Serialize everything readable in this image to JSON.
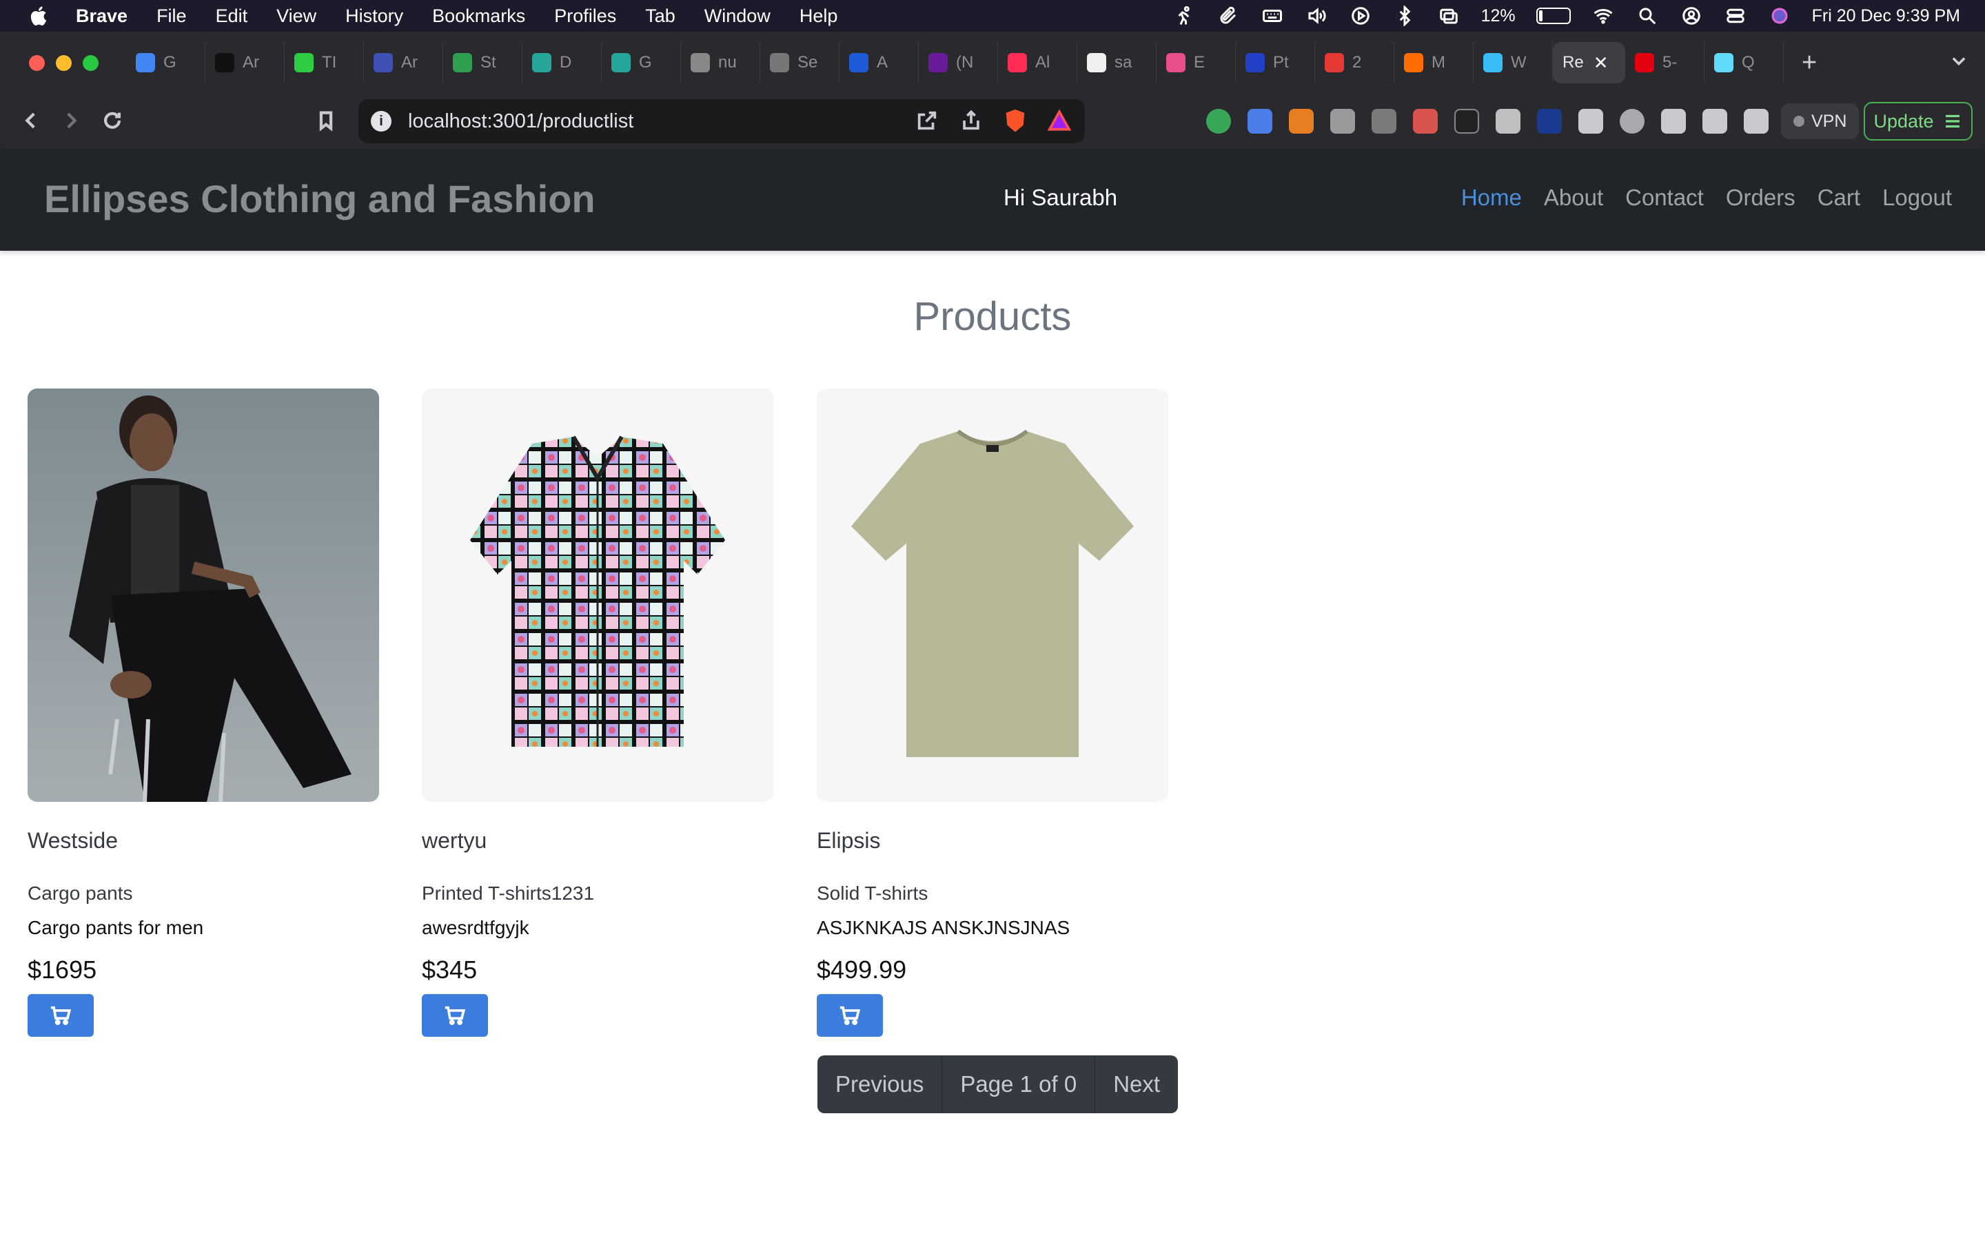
{
  "menubar": {
    "app": "Brave",
    "items": [
      "File",
      "Edit",
      "View",
      "History",
      "Bookmarks",
      "Profiles",
      "Tab",
      "Window",
      "Help"
    ],
    "battery_percent": "12%",
    "battery_level": 0.12,
    "datetime": "Fri 20 Dec  9:39 PM"
  },
  "tabs": [
    {
      "label": "G",
      "color": "#4285f4"
    },
    {
      "label": "Ar",
      "color": "#111111"
    },
    {
      "label": "TI",
      "color": "#2ecc40"
    },
    {
      "label": "Ar",
      "color": "#3f51b5"
    },
    {
      "label": "St",
      "color": "#2e9e4f"
    },
    {
      "label": "D",
      "color": "#26a69a"
    },
    {
      "label": "G",
      "color": "#26a69a"
    },
    {
      "label": "nu",
      "color": "#888888"
    },
    {
      "label": "Se",
      "color": "#777777"
    },
    {
      "label": "A",
      "color": "#1e5bd8"
    },
    {
      "label": "(N",
      "color": "#6a1b9a"
    },
    {
      "label": "Al",
      "color": "#ff2d55"
    },
    {
      "label": "sa",
      "color": "#f0f0f0"
    },
    {
      "label": "E",
      "color": "#e94d8b"
    },
    {
      "label": "Pt",
      "color": "#2340c8"
    },
    {
      "label": "2",
      "color": "#e53935"
    },
    {
      "label": "M",
      "color": "#ff6d00"
    },
    {
      "label": "W",
      "color": "#38bdf8"
    },
    {
      "label": "Re",
      "color": "#3d3d42",
      "active": true
    },
    {
      "label": "5-",
      "color": "#e50010"
    },
    {
      "label": "Q",
      "color": "#61dafb"
    }
  ],
  "toolbar": {
    "url": "localhost:3001/productlist",
    "vpn_label": "VPN",
    "update_label": "Update"
  },
  "site": {
    "brand": "Ellipses Clothing and Fashion",
    "greeting": "Hi Saurabh",
    "nav": [
      "Home",
      "About",
      "Contact",
      "Orders",
      "Cart",
      "Logout"
    ],
    "active_nav": "Home"
  },
  "page": {
    "title": "Products"
  },
  "products": [
    {
      "brand": "Westside",
      "category": "Cargo pants",
      "description": "Cargo pants for men",
      "price": "$1695"
    },
    {
      "brand": "wertyu",
      "category": "Printed T-shirts1231",
      "description": "awesrdtfgyjk",
      "price": "$345"
    },
    {
      "brand": "Elipsis",
      "category": "Solid T-shirts",
      "description": "ASJKNKAJS ANSKJNSJNAS",
      "price": "$499.99"
    }
  ],
  "pagination": {
    "previous": "Previous",
    "status": "Page 1 of 0",
    "next": "Next"
  }
}
